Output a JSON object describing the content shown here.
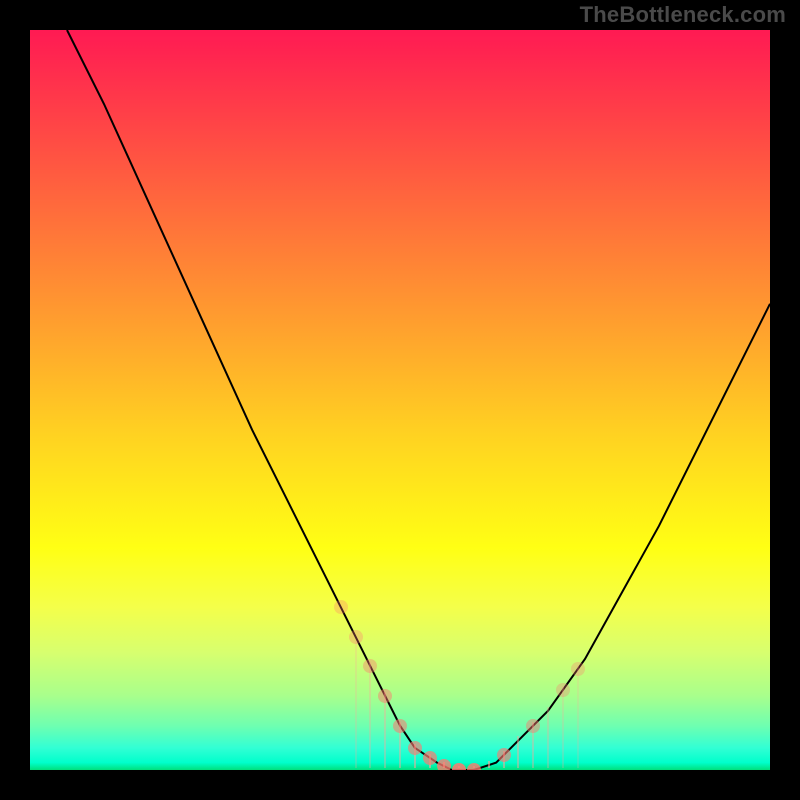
{
  "watermark": "TheBottleneck.com",
  "colors": {
    "frame": "#000000",
    "curve": "#000000",
    "tick": "rgba(255,166,152,0.75)",
    "blob": "rgba(255,120,110,0.85)",
    "gradient_top": "#ff1a53",
    "gradient_bottom": "#00e07b"
  },
  "chart_data": {
    "type": "line",
    "title": "",
    "xlabel": "",
    "ylabel": "",
    "xlim": [
      0,
      100
    ],
    "ylim": [
      0,
      100
    ],
    "series": [
      {
        "name": "bottleneck-curve",
        "x": [
          5,
          10,
          15,
          20,
          25,
          30,
          35,
          40,
          45,
          48,
          50,
          52,
          55,
          57,
          60,
          63,
          65,
          70,
          75,
          80,
          85,
          90,
          95,
          100
        ],
        "y": [
          100,
          90,
          79,
          68,
          57,
          46,
          36,
          26,
          16,
          10,
          6,
          3,
          1,
          0,
          0,
          1,
          3,
          8,
          15,
          24,
          33,
          43,
          53,
          63
        ]
      }
    ],
    "ticks_x": [
      42,
      44,
      46,
      48,
      50,
      52,
      54,
      56,
      58,
      60,
      62,
      64,
      66,
      68,
      70,
      72,
      74
    ],
    "bottom_band_frac": 0.88
  }
}
